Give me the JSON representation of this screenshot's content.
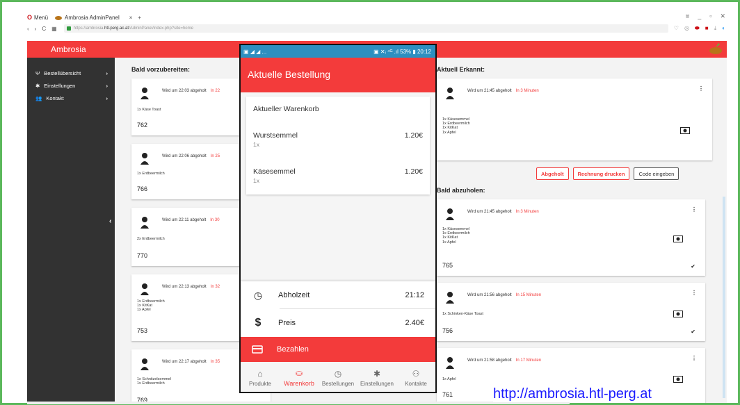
{
  "browser": {
    "menu_label": "Menü",
    "tab_title": "Ambrosia AdminPanel",
    "tab_close": "×",
    "new_tab": "+",
    "url_prefix": "https://ambrosia.",
    "url_host": "htl-perg.ac.at",
    "url_path": "/AdminPanel/index.php?site=home"
  },
  "app": {
    "brand": "Ambrosia",
    "accent": "#f33b3b"
  },
  "sidebar": {
    "items": [
      {
        "label": "Bestellübersicht",
        "icon": "cutlery-icon"
      },
      {
        "label": "Einstellungen",
        "icon": "gear-icon"
      },
      {
        "label": "Kontakt",
        "icon": "users-icon"
      }
    ]
  },
  "left_column": {
    "title": "Bald vorzubereiten:",
    "cards": [
      {
        "pickup": "Wird um 22:03 abgeholt",
        "when": "In 22",
        "items": [
          "1x Käse Toast"
        ],
        "number": "762"
      },
      {
        "pickup": "Wird um 22:06 abgeholt",
        "when": "In 25",
        "items": [
          "1x Erdbeermilch"
        ],
        "number": "766"
      },
      {
        "pickup": "Wird um 22:11 abgeholt",
        "when": "In 30",
        "items": [
          "2x Erdbeermilch"
        ],
        "number": "770"
      },
      {
        "pickup": "Wird um 22:13 abgeholt",
        "when": "In 32",
        "items": [
          "1x Erdbeermilch",
          "1x KitKat",
          "1x Apfel"
        ],
        "number": "753"
      },
      {
        "pickup": "Wird um 22:17 abgeholt",
        "when": "In 35",
        "items": [
          "1x Schnitzelsemmel",
          "1x Erdbeermilch"
        ],
        "number": "769"
      }
    ]
  },
  "right_column": {
    "recognized_title": "Aktuell Erkannt:",
    "recognized_card": {
      "pickup": "Wird um 21:45 abgeholt",
      "when": "In 3 Minuten",
      "items": [
        "1x Käsesemmel",
        "1x Erdbeermilch",
        "1x KitKat",
        "1x Apfel"
      ]
    },
    "buttons": {
      "picked_up": "Abgeholt",
      "print_invoice": "Rechnung drucken",
      "enter_code": "Code eingeben"
    },
    "pickup_title": "Bald abzuholen:",
    "pickup_cards": [
      {
        "pickup": "Wird um 21:45 abgeholt",
        "when": "In 3 Minuten",
        "items": [
          "1x Käsesemmel",
          "1x Erdbeermilch",
          "1x KitKat",
          "1x Apfel"
        ],
        "number": "765"
      },
      {
        "pickup": "Wird um 21:56 abgeholt",
        "when": "In 15 Minuten",
        "items": [
          "1x Schinken-Käse Toast"
        ],
        "number": "756"
      },
      {
        "pickup": "Wird um 21:58 abgeholt",
        "when": "In 17 Minuten",
        "items": [
          "1x Apfel"
        ],
        "number": "761"
      }
    ]
  },
  "phone": {
    "status_left": "▣ ◢ ◢ ...",
    "status_right": "▣ ✕ᵢ ⁴ᴳ .ıl 53% ▮ 20:12",
    "title": "Aktuelle Bestellung",
    "cart": {
      "heading": "Aktueller Warenkorb",
      "rows": [
        {
          "name": "Wurstsemmel",
          "qty": "1x",
          "price": "1.20€"
        },
        {
          "name": "Käsesemmel",
          "qty": "1x",
          "price": "1.20€"
        }
      ]
    },
    "pickup_time_label": "Abholzeit",
    "pickup_time_value": "21:12",
    "price_label": "Preis",
    "price_value": "2.40€",
    "pay_label": "Bezahlen",
    "nav": [
      {
        "label": "Produkte",
        "icon": "home-icon"
      },
      {
        "label": "Warenkorb",
        "icon": "basket-icon"
      },
      {
        "label": "Bestellungen",
        "icon": "clock-icon"
      },
      {
        "label": "Einstellungen",
        "icon": "gear-icon"
      },
      {
        "label": "Kontakte",
        "icon": "contacts-icon"
      }
    ]
  },
  "footer_url": "http://ambrosia.htl-perg.at"
}
